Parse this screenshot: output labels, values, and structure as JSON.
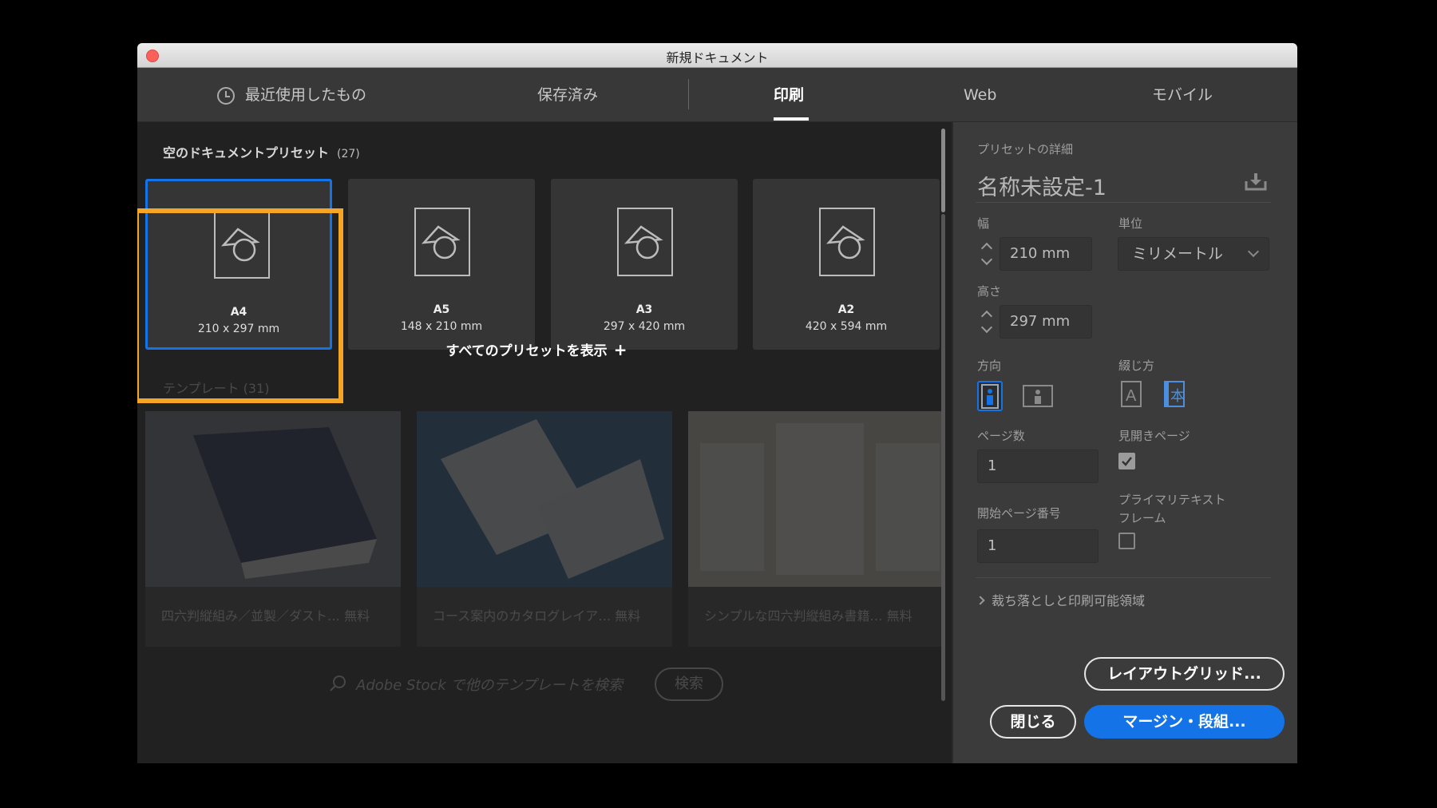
{
  "window": {
    "title": "新規ドキュメント"
  },
  "tabs": [
    {
      "label": "最近使用したもの"
    },
    {
      "label": "保存済み"
    },
    {
      "label": "印刷"
    },
    {
      "label": "Web"
    },
    {
      "label": "モバイル"
    }
  ],
  "presets": {
    "section_title": "空のドキュメントプリセット",
    "count": "(27)",
    "items": [
      {
        "name": "A4",
        "size": "210 x 297 mm"
      },
      {
        "name": "A5",
        "size": "148 x 210 mm"
      },
      {
        "name": "A3",
        "size": "297 x 420 mm"
      },
      {
        "name": "A2",
        "size": "420 x 594 mm"
      }
    ],
    "show_all": "すべてのプリセットを表示"
  },
  "templates": {
    "section_title": "テンプレート",
    "count": "(31)",
    "items": [
      {
        "caption": "四六判縦組み／並製／ダスト…",
        "badge": "無料"
      },
      {
        "caption": "コース案内のカタログレイア…",
        "badge": "無料"
      },
      {
        "caption": "シンプルな四六判縦組み書籍…",
        "badge": "無料"
      }
    ],
    "stock_search": "Adobe Stock で他のテンプレートを検索",
    "search_button": "検索"
  },
  "details": {
    "header": "プリセットの詳細",
    "name": "名称未設定-1",
    "width_label": "幅",
    "width_value": "210 mm",
    "unit_label": "単位",
    "unit_value": "ミリメートル",
    "height_label": "高さ",
    "height_value": "297 mm",
    "orientation_label": "方向",
    "binding_label": "綴じ方",
    "pages_label": "ページ数",
    "pages_value": "1",
    "facing_label": "見開きページ",
    "start_page_label": "開始ページ番号",
    "start_page_value": "1",
    "primary_frame_label_1": "プライマリテキスト",
    "primary_frame_label_2": "フレーム",
    "bleed_label": "裁ち落としと印刷可能領域"
  },
  "buttons": {
    "layout_grid": "レイアウトグリッド...",
    "close": "閉じる",
    "margin": "マージン・段組..."
  },
  "colors": {
    "accent": "#1473e6",
    "highlight": "#f4a524"
  }
}
